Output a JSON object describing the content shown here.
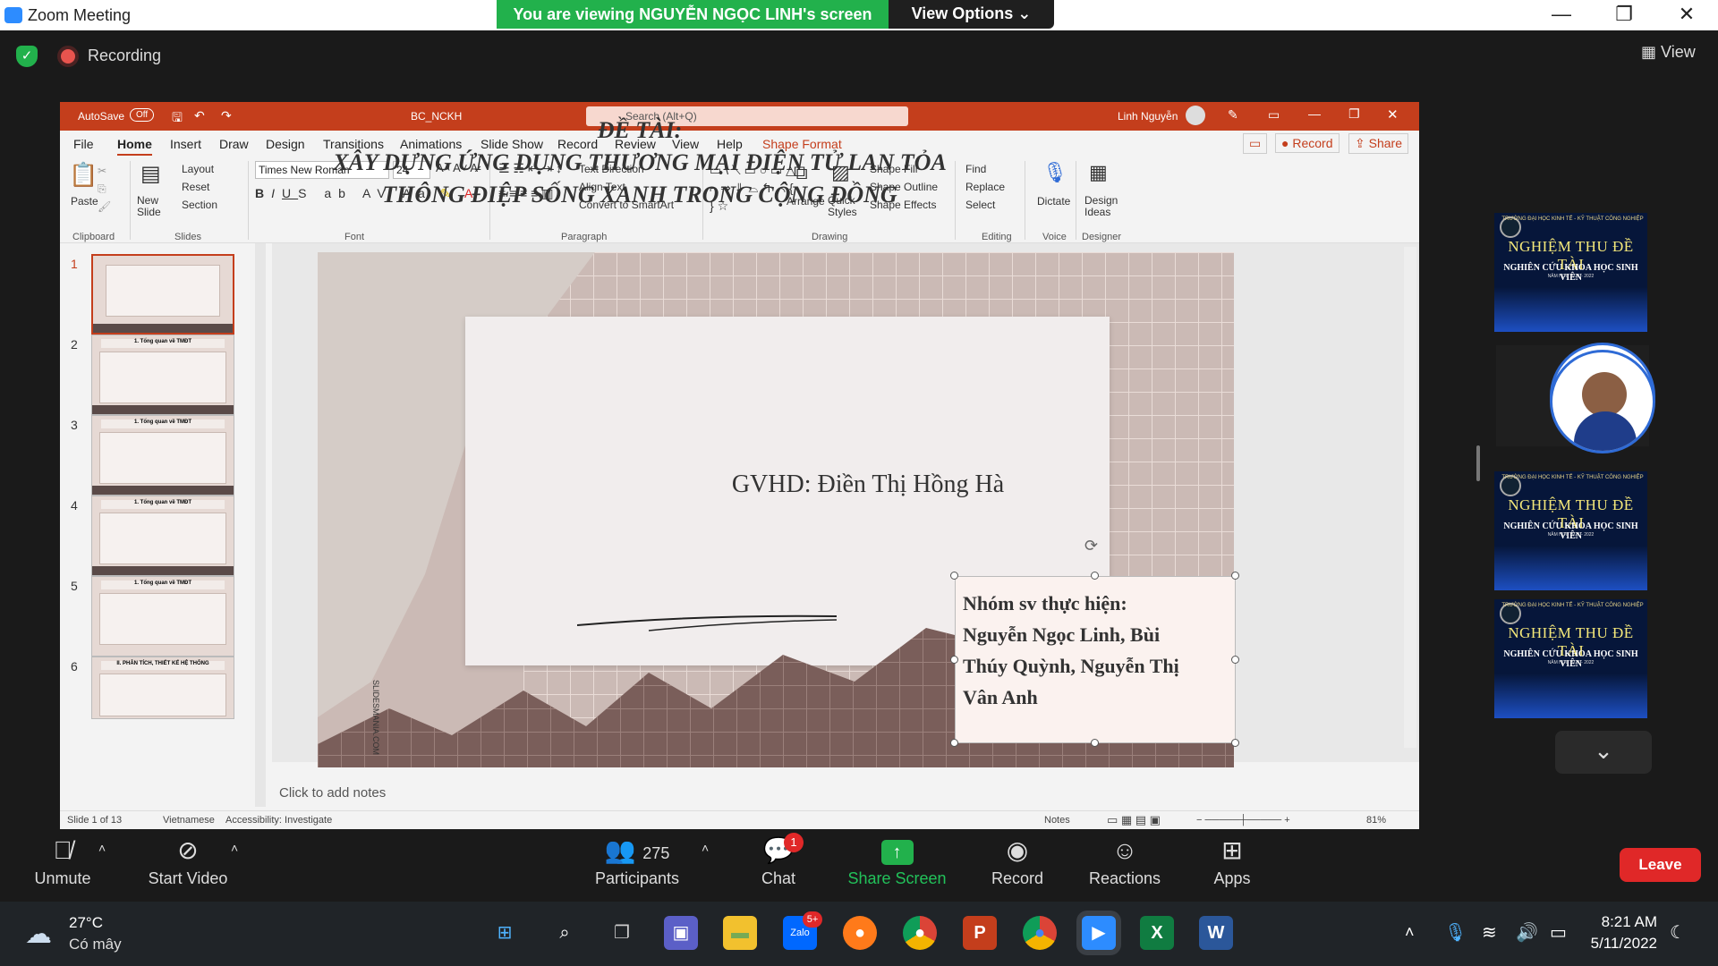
{
  "zoom": {
    "window_title": "Zoom Meeting",
    "viewing_banner": "You are viewing NGUYỄN NGỌC LINH's screen",
    "view_options": "View Options",
    "recording": "Recording",
    "view": "View",
    "controls": {
      "unmute": "Unmute",
      "start_video": "Start Video",
      "participants": "Participants",
      "participants_count": "275",
      "chat": "Chat",
      "chat_badge": "1",
      "share_screen": "Share Screen",
      "record": "Record",
      "reactions": "Reactions",
      "apps": "Apps",
      "leave": "Leave"
    },
    "tiles": [
      {
        "line1": "TRƯỜNG ĐẠI HỌC KINH TẾ - KỸ THUẬT CÔNG NGHIỆP",
        "title": "NGHIỆM THU ĐỀ TÀI",
        "subtitle": "NGHIÊN CỨU KHOA HỌC SINH VIÊN",
        "year": "NĂM HỌC 2021 - 2022"
      },
      {
        "line1": "TRƯỜNG ĐẠI HỌC KINH TẾ - KỸ THUẬT CÔNG NGHIỆP",
        "title": "NGHIỆM THU ĐỀ TÀI",
        "subtitle": "NGHIÊN CỨU KHOA HỌC SINH VIÊN",
        "year": "NĂM HỌC 2021 - 2022"
      },
      {
        "line1": "TRƯỜNG ĐẠI HỌC KINH TẾ - KỸ THUẬT CÔNG NGHIỆP",
        "title": "NGHIỆM THU ĐỀ TÀI",
        "subtitle": "NGHIÊN CỨU KHOA HỌC SINH VIÊN",
        "year": "NĂM HỌC 2021 - 2022"
      }
    ]
  },
  "ppt": {
    "autosave": "AutoSave",
    "autosave_state": "Off",
    "filename": "BC_NCKH",
    "search_placeholder": "Search (Alt+Q)",
    "user": "Linh Nguyễn",
    "tabs": [
      "File",
      "Home",
      "Insert",
      "Draw",
      "Design",
      "Transitions",
      "Animations",
      "Slide Show",
      "Record",
      "Review",
      "View",
      "Help",
      "Shape Format"
    ],
    "record_btn": "Record",
    "share_btn": "Share",
    "ribbon": {
      "paste": "Paste",
      "new_slide": "New Slide",
      "layout": "Layout",
      "reset": "Reset",
      "section": "Section",
      "font_name": "Times New Roman",
      "font_size": "24",
      "text_direction": "Text Direction",
      "align_text": "Align Text",
      "convert_smartart": "Convert to SmartArt",
      "arrange": "Arrange",
      "quick_styles": "Quick Styles",
      "shape_fill": "Shape Fill",
      "shape_outline": "Shape Outline",
      "shape_effects": "Shape Effects",
      "find": "Find",
      "replace": "Replace",
      "select": "Select",
      "dictate": "Dictate",
      "design_ideas": "Design Ideas",
      "groups": [
        "Clipboard",
        "Slides",
        "Font",
        "Paragraph",
        "Drawing",
        "Editing",
        "Voice",
        "Designer"
      ]
    },
    "thumbnails": [
      {
        "num": "1",
        "title": ""
      },
      {
        "num": "2",
        "title": "1. Tổng quan về TMĐT"
      },
      {
        "num": "3",
        "title": "1. Tổng quan về TMĐT"
      },
      {
        "num": "4",
        "title": "1. Tổng quan về TMĐT"
      },
      {
        "num": "5",
        "title": "1. Tổng quan về TMĐT"
      },
      {
        "num": "6",
        "title": "II. PHÂN TÍCH, THIẾT KẾ HỆ THỐNG"
      }
    ],
    "slide": {
      "heading": "ĐỀ TÀI:",
      "title_line1": "XÂY DỰNG ỨNG DỤNG THƯƠNG MẠI ĐIỆN TỬ LAN TỎA",
      "title_line2": "THÔNG ĐIỆP SỐNG XANH TRONG CỘNG ĐỒNG",
      "gvhd": "GVHD: Điền Thị Hồng Hà",
      "box_line1": "Nhóm sv thực hiện:",
      "box_line2": "Nguyễn Ngọc Linh,  Bùi",
      "box_line3": "Thúy Quỳnh, Nguyễn Thị",
      "box_line4": "Vân Anh",
      "watermark": "SLIDESMANIA.COM"
    },
    "notes_placeholder": "Click to add notes",
    "status": {
      "slide": "Slide 1 of 13",
      "language": "Vietnamese",
      "accessibility": "Accessibility: Investigate",
      "notes": "Notes",
      "zoom": "81%"
    }
  },
  "taskbar": {
    "temperature": "27°C",
    "weather": "Có mây",
    "time": "8:21 AM",
    "date": "5/11/2022",
    "zalo_badge": "5+"
  },
  "colors": {
    "zoom_green": "#22b14c",
    "ppt_red": "#c43e1c",
    "leave_red": "#e02828"
  }
}
